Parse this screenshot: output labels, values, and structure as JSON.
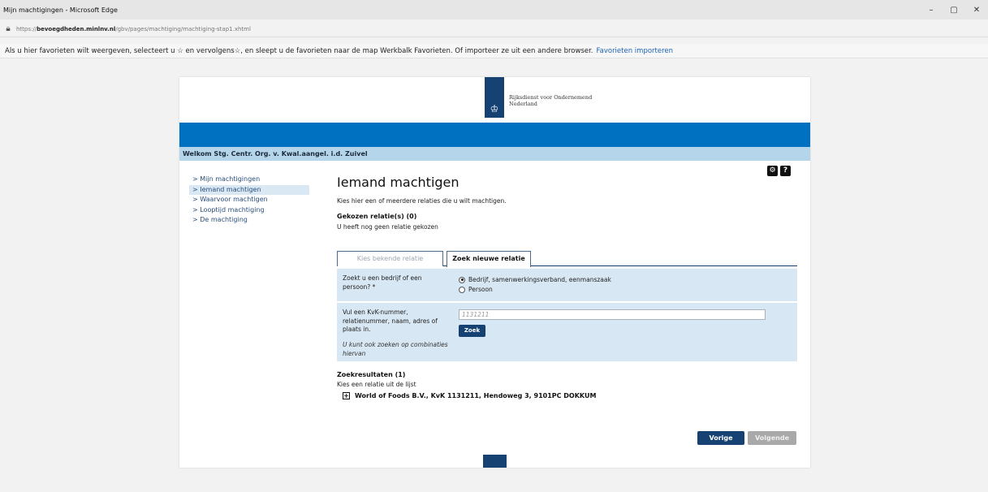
{
  "window": {
    "title": "Mijn machtigingen - Microsoft Edge",
    "minimize": "–",
    "maximize": "▢",
    "close": "✕"
  },
  "address": {
    "prefix": "https://",
    "domain": "bevoegdheden.minlnv.nl",
    "path": "/gbv/pages/machtiging/machtiging-stap1.xhtml"
  },
  "favbar": {
    "text": "Als u hier favorieten wilt weergeven, selecteert u ☆ en vervolgens☆, en sleept u de favorieten naar de map Werkbalk Favorieten. Of importeer ze uit een andere browser.",
    "link": "Favorieten importeren"
  },
  "header": {
    "logo_line1": "Rijksdienst voor Ondernemend",
    "logo_line2": "Nederland",
    "welcome": "Welkom Stg. Centr. Org. v. Kwal.aangel. i.d. Zuivel"
  },
  "sidebar": {
    "items": [
      {
        "label": "> Mijn machtigingen"
      },
      {
        "label": "> Iemand machtigen"
      },
      {
        "label": "> Waarvoor machtigen"
      },
      {
        "label": "> Looptijd machtiging"
      },
      {
        "label": "> De machtiging"
      }
    ]
  },
  "main": {
    "title": "Iemand machtigen",
    "intro": "Kies hier een of meerdere relaties die u wilt machtigen.",
    "chosen_heading": "Gekozen relatie(s) (0)",
    "chosen_empty": "U heeft nog geen relatie gekozen",
    "tabs": [
      {
        "label": "Kies bekende relatie"
      },
      {
        "label": "Zoek nieuwe relatie"
      }
    ],
    "question_label": "Zoekt u een bedrijf of een persoon? *",
    "radio_options": [
      {
        "label": "Bedrijf, samenwerkingsverband, eenmanszaak",
        "selected": true
      },
      {
        "label": "Persoon",
        "selected": false
      }
    ],
    "search_label": "Vul een KvK-nummer, relatienummer, naam, adres of plaats in.",
    "search_hint": "U kunt ook zoeken op combinaties hiervan",
    "search_value": "1131211",
    "search_button": "Zoek",
    "results_heading": "Zoekresultaten (1)",
    "results_sub": "Kies een relatie uit de lijst",
    "results": [
      {
        "label": "World of Foods B.V., KvK 1131211, Hendoweg 3, 9101PC DOKKUM"
      }
    ],
    "prev_button": "Vorige",
    "next_button": "Volgende"
  },
  "colors": {
    "brand_blue": "#0071c1",
    "dark_blue": "#154273",
    "light_blue": "#b4d5ea",
    "panel_blue": "#d7e7f3"
  }
}
